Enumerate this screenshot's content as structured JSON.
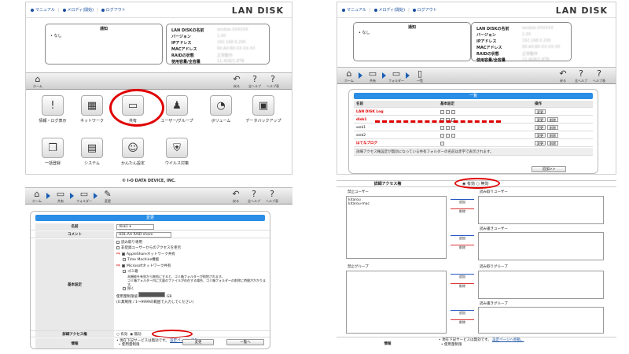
{
  "colors": {
    "accent": "#2a8ee6",
    "highlight": "#e00000",
    "link": "#1a4fa0"
  },
  "top_links": [
    "マニュアル",
    "メロディ(開始)",
    "ログアウト"
  ],
  "logo": "LAN DISK",
  "left_top": {
    "notice_title": "通知",
    "notice_items": [
      "なし"
    ],
    "info_labels": [
      "LAN DISKの名前",
      "バージョン",
      "IPアドレス",
      "MACアドレス",
      "RAIDの状態",
      "使用容量/全容量"
    ],
    "info_values": [
      "landisk-XXXXXX",
      "1.00",
      "192.168.0.200",
      "00:A0:B0:XX:XX:XX",
      "正常動作",
      "11.4GB/1.8TB"
    ],
    "nav": {
      "home": "ホーム",
      "back": "戻る",
      "help_all": "全ヘルプ",
      "help": "ヘルプ表"
    },
    "tiles": [
      {
        "label": "情報・ログ表示",
        "icon": "!"
      },
      {
        "label": "ネットワーク",
        "icon": "▦"
      },
      {
        "label": "共有",
        "icon": "▭"
      },
      {
        "label": "ユーザー/グループ",
        "icon": "♟"
      },
      {
        "label": "ボリューム",
        "icon": "◔"
      },
      {
        "label": "データバックアップ",
        "icon": "▣"
      },
      {
        "label": "一括登録",
        "icon": "❐"
      },
      {
        "label": "システム",
        "icon": "▤"
      },
      {
        "label": "かんたん設定",
        "icon": "☺"
      },
      {
        "label": "ウイルス対策",
        "icon": "⛨"
      }
    ],
    "copyright": "© I-O DATA DEVICE, INC."
  },
  "left_bottom": {
    "nav": {
      "home": "ホーム",
      "share": "共有",
      "folder": "フォルダー",
      "settings": "変更",
      "back": "戻る",
      "help_all": "全ヘルプ",
      "help": "ヘルプ表"
    },
    "header": "変更",
    "name_label": "名前",
    "name_value": "disk1",
    "comment_label": "コメント",
    "comment_value": "HDL-AA RAID share",
    "basic_label": "基本設定",
    "options": [
      {
        "text": "読み取り専用",
        "checked": false,
        "marked": false,
        "indent": false
      },
      {
        "text": "非登録ユーザーからのアクセスを拒否",
        "checked": false,
        "marked": false,
        "indent": false
      },
      {
        "text": "AppleShareネットワーク共有",
        "checked": true,
        "marked": true,
        "indent": false
      },
      {
        "text": "Time Machine機能",
        "checked": false,
        "marked": false,
        "indent": true
      },
      {
        "text": "Microsoftネットワーク共有",
        "checked": true,
        "marked": true,
        "indent": false
      },
      {
        "text": "ゴミ箱",
        "checked": false,
        "marked": false,
        "indent": true
      }
    ],
    "trash_note1": "本機能を有効から無効にすると、ゴミ箱フォルダーが削除されます。",
    "trash_note2": "ゴミ箱フォルダー内に大量のファイルが存在する場合、ゴミ箱フォルダーの削除に時間がかかります。",
    "trash_note3": "除く",
    "capacity_label": "使用量制限値",
    "capacity_unit": "GB",
    "capacity_note": "(0:無制限 / 1〜9999の範囲で入力してください)",
    "detail_label": "詳細アクセス権",
    "detail_on": "有効",
    "detail_off": "無効",
    "info_label": "情報",
    "info_text1": "現在下記サービスは無効です。",
    "info_link": "設定ページへ移動。",
    "info_text2": "使用量制限",
    "btn_change": "変更",
    "btn_list": "一覧へ"
  },
  "right_top": {
    "nav": {
      "home": "ホーム",
      "share": "共有",
      "folder": "フォルダー",
      "list": "一覧",
      "back": "戻る",
      "help_all": "全ヘルプ",
      "help": "ヘルプ表"
    },
    "header": "一覧",
    "columns": [
      "名前",
      "基本設定",
      "操作"
    ],
    "rows": [
      {
        "name": "LAN DISK Log",
        "red": true,
        "ops": [
          "変更"
        ]
      },
      {
        "name": "disk1",
        "red": true,
        "ops": [
          "変更",
          "削除"
        ]
      },
      {
        "name": "web1",
        "red": false,
        "ops": [
          "変更",
          "削除"
        ]
      },
      {
        "name": "web2",
        "red": false,
        "ops": [
          "変更",
          "削除"
        ]
      },
      {
        "name": "はてなブログ",
        "red": true,
        "ops": [
          "変更",
          "削除"
        ]
      }
    ],
    "note": "詳細アクセス権設定が無効になっている共有フォルダーの名前は赤字で表示されます。",
    "add_btn": "追加>>"
  },
  "right_bottom": {
    "detail_label": "詳細アクセス権",
    "detail_on": "有効",
    "detail_off": "無効",
    "deny_user": "禁止ユーザー",
    "read_user": "読み取りユーザー",
    "rw_user": "読み書きユーザー",
    "users": [
      "kitarou",
      "kitarou-mac"
    ],
    "add": "追加",
    "del": "削除",
    "deny_group": "禁止グループ",
    "read_group": "読み取りグループ",
    "rw_group": "読み書きグループ",
    "info_label": "情報",
    "info_text1": "現在下記サービスは無効です。",
    "info_link": "設定ページへ移動。",
    "info_text2": "使用量制限"
  }
}
